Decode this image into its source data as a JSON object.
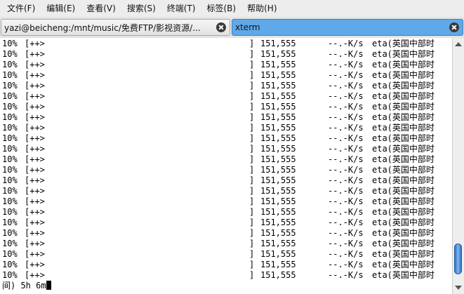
{
  "menubar": {
    "items": [
      {
        "label": "文件(F)"
      },
      {
        "label": "编辑(E)"
      },
      {
        "label": "查看(V)"
      },
      {
        "label": "搜索(S)"
      },
      {
        "label": "终端(T)"
      },
      {
        "label": "标签(B)"
      },
      {
        "label": "帮助(H)"
      }
    ]
  },
  "tabs": [
    {
      "label": "yazi@beicheng:/mnt/music/免费FTP/影视资源/...",
      "active": false
    },
    {
      "label": "xterm",
      "active": true
    }
  ],
  "terminal": {
    "progress_line": {
      "percent": "10%",
      "bar": "[++>",
      "bar_end": "]",
      "bytes": "151,555",
      "speed": "--.-K/s",
      "eta": "eta(英国中部时"
    },
    "repeat_count": 23,
    "last_line": "间) 5h 6m"
  },
  "scrollbar": {
    "position": 0.96
  },
  "colors": {
    "active_tab": "#5fa9e8",
    "scroll_thumb": "#4a8fd8"
  }
}
